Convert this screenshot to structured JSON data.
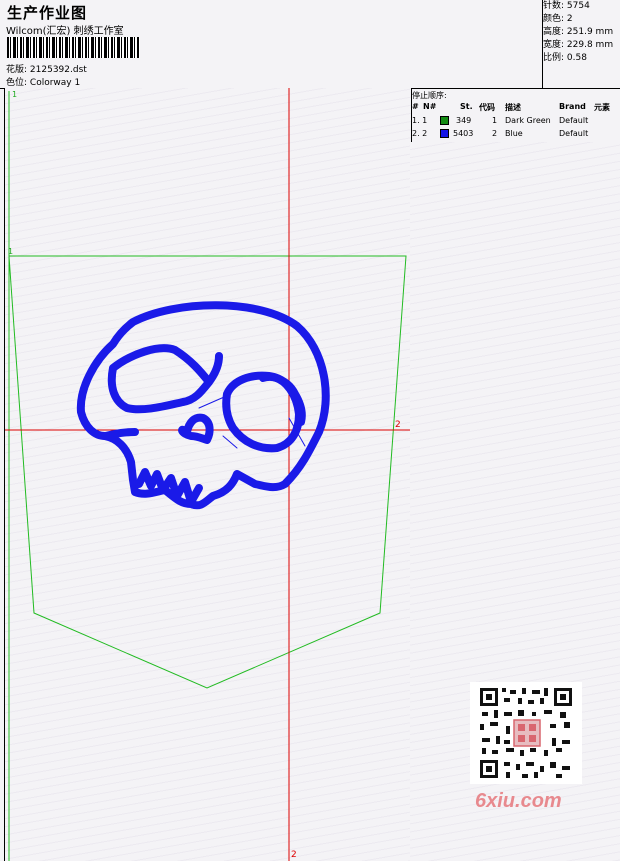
{
  "header": {
    "title": "生产作业图",
    "company": "Wilcom(汇宏) 刺绣工作室",
    "design_label": "花版:",
    "design_file": "2125392.dst",
    "colorway_label": "色位:",
    "colorway": "Colorway 1"
  },
  "stats": {
    "stitches_label": "针数:",
    "stitches": "5754",
    "colors_label": "颜色:",
    "colors": "2",
    "height_label": "高度:",
    "height": "251.9 mm",
    "width_label": "宽度:",
    "width": "229.8 mm",
    "scale_label": "比例:",
    "scale": "0.58"
  },
  "stop_sequence": {
    "title": "停止顺序:",
    "headers": [
      "#",
      "N#",
      "St.",
      "代码",
      "描述",
      "Brand",
      "元素"
    ],
    "rows": [
      {
        "num": "1. 1",
        "color": "#148c14",
        "stitches": "349",
        "code": "1",
        "description": "Dark Green",
        "brand": "Default"
      },
      {
        "num": "2. 2",
        "color": "#1414e6",
        "stitches": "5403",
        "code": "2",
        "description": "Blue",
        "brand": "Default"
      }
    ]
  },
  "canvas": {
    "marker_top_left": "1",
    "marker_left_mid": "1",
    "marker_right": "2",
    "marker_bottom": "2",
    "pocket_color": "#22bb22",
    "crosshair_color": "#dd0000",
    "skull_color": "#1a1ae8"
  },
  "watermark": {
    "text": "6xiu.com"
  }
}
